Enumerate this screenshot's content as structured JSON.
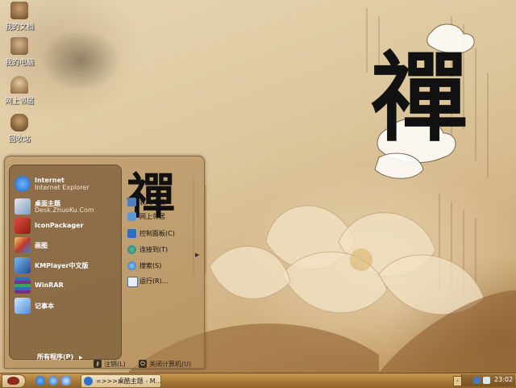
{
  "desktop": {
    "icons": [
      {
        "label": "我的文档",
        "icon": "my-documents-icon"
      },
      {
        "label": "我的电脑",
        "icon": "my-computer-icon"
      },
      {
        "label": "网上邻居",
        "icon": "network-places-icon"
      },
      {
        "label": "回收站",
        "icon": "recycle-bin-icon"
      }
    ],
    "wallpaper_char": "禪"
  },
  "start_menu": {
    "pinned": [
      {
        "title": "Internet",
        "subtitle": "Internet Explorer",
        "icon": "internet-explorer-icon"
      },
      {
        "title": "桌面主题",
        "subtitle": "Desk.ZhuoKu.Com",
        "icon": "desktop-theme-icon"
      },
      {
        "title": "IconPackager",
        "subtitle": "",
        "icon": "iconpackager-icon"
      },
      {
        "title": "画图",
        "subtitle": "",
        "icon": "paint-icon"
      },
      {
        "title": "KMPlayer中文版",
        "subtitle": "",
        "icon": "kmplayer-icon"
      },
      {
        "title": "WinRAR",
        "subtitle": "",
        "icon": "winrar-icon"
      },
      {
        "title": "记事本",
        "subtitle": "",
        "icon": "notepad-icon"
      }
    ],
    "all_programs": "所有程序(P)",
    "all_programs_arrow": "▶",
    "right_items": [
      {
        "label": "我的电脑",
        "icon": "computer-icon"
      },
      {
        "label": "网上邻居",
        "icon": "network-icon"
      },
      {
        "label": "控制面板(C)",
        "icon": "control-panel-icon"
      },
      {
        "label": "连接到(T)",
        "icon": "connect-icon"
      },
      {
        "label": "搜索(S)",
        "icon": "search-icon"
      },
      {
        "label": "运行(R)...",
        "icon": "run-icon"
      }
    ],
    "right_arrow": "▶",
    "logoff": "注销(L)",
    "shutdown": "关闭计算机(U)",
    "banner_char": "禪"
  },
  "taskbar": {
    "task_label": "=>>>桌酷主题 - M...",
    "clock": "23:02",
    "tray_arrow": "‹"
  },
  "colors": {
    "taskbar": "#a77838",
    "menu_left_pane": "#785a37",
    "menu_text": "#ffffff"
  }
}
